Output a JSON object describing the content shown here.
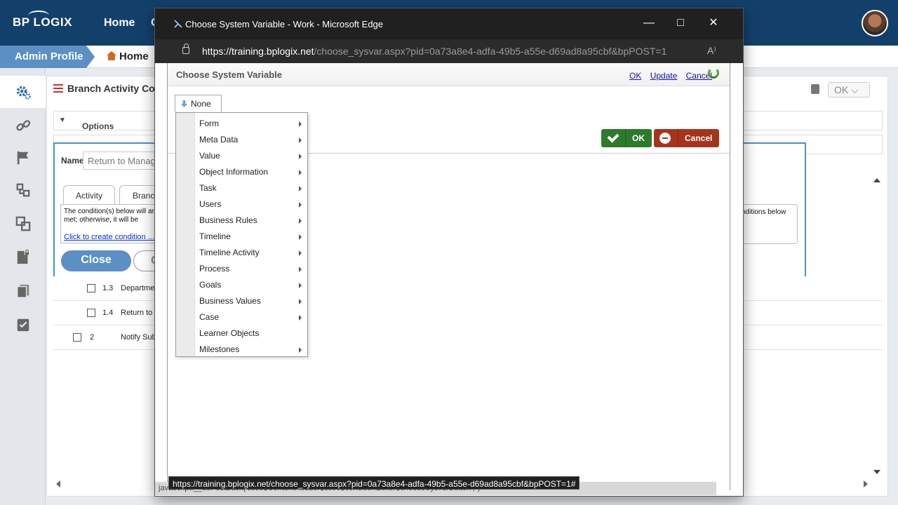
{
  "app": {
    "logo": "BP LOGIX",
    "nav": [
      "Home",
      "C"
    ],
    "breadcrumb": {
      "admin": "Admin Profile",
      "home": "Home"
    }
  },
  "page": {
    "title": "Branch Activity Con",
    "ok_top": "OK",
    "options_label": "Options",
    "name_label": "Name",
    "name_value": "Return to Manage",
    "tabs": [
      "Activity",
      "Branch"
    ],
    "condition_text": "The condition(s) below will are met; otherwise, it will be",
    "condition_link": "Click to create condition ...",
    "condition_right": "nditions below",
    "close_label": "Close",
    "close2_label": "C",
    "rows": [
      {
        "num": "1.3",
        "label": "Departme"
      },
      {
        "num": "1.4",
        "label": "Return to"
      },
      {
        "num": "2",
        "label": "Notify Sub"
      }
    ]
  },
  "popup": {
    "window_title": "Choose System Variable - Work - Microsoft Edge",
    "url_host": "https://training.bplogix.net",
    "url_path": "/choose_sysvar.aspx?pid=0a73a8e4-adfa-49b5-a55e-d69ad8a95cbf&bpPOST=1",
    "header_title": "Choose System Variable",
    "links": [
      "OK",
      "Update",
      "Cancel"
    ],
    "none_label": "None",
    "ok_button": "OK",
    "cancel_button": "Cancel",
    "menu_items": [
      {
        "label": "Form",
        "submenu": true
      },
      {
        "label": "Meta Data",
        "submenu": true
      },
      {
        "label": "Value",
        "submenu": true
      },
      {
        "label": "Object Information",
        "submenu": true
      },
      {
        "label": "Task",
        "submenu": true
      },
      {
        "label": "Users",
        "submenu": true
      },
      {
        "label": "Business Rules",
        "submenu": true
      },
      {
        "label": "Timeline",
        "submenu": true
      },
      {
        "label": "Timeline Activity",
        "submenu": true
      },
      {
        "label": "Process",
        "submenu": true
      },
      {
        "label": "Goals",
        "submenu": true
      },
      {
        "label": "Business Values",
        "submenu": true
      },
      {
        "label": "Case",
        "submenu": true
      },
      {
        "label": "Learner Objects",
        "submenu": false
      },
      {
        "label": "Milestones",
        "submenu": true
      }
    ],
    "status_url": "https://training.bplogix.net/choose_sysvar.aspx?pid=0a73a8e4-adfa-49b5-a55e-d69ad8a95cbf&bpPOST=1#",
    "status_under": "javascript:__doPostBack('ctl00$ContentHeader$ctl00$conditionEditor$chooseSysvarButton','')"
  },
  "colors": {
    "header": "#13406b",
    "accent": "#5c8fc4",
    "ok": "#2d7a2d",
    "cancel": "#a4341a"
  }
}
